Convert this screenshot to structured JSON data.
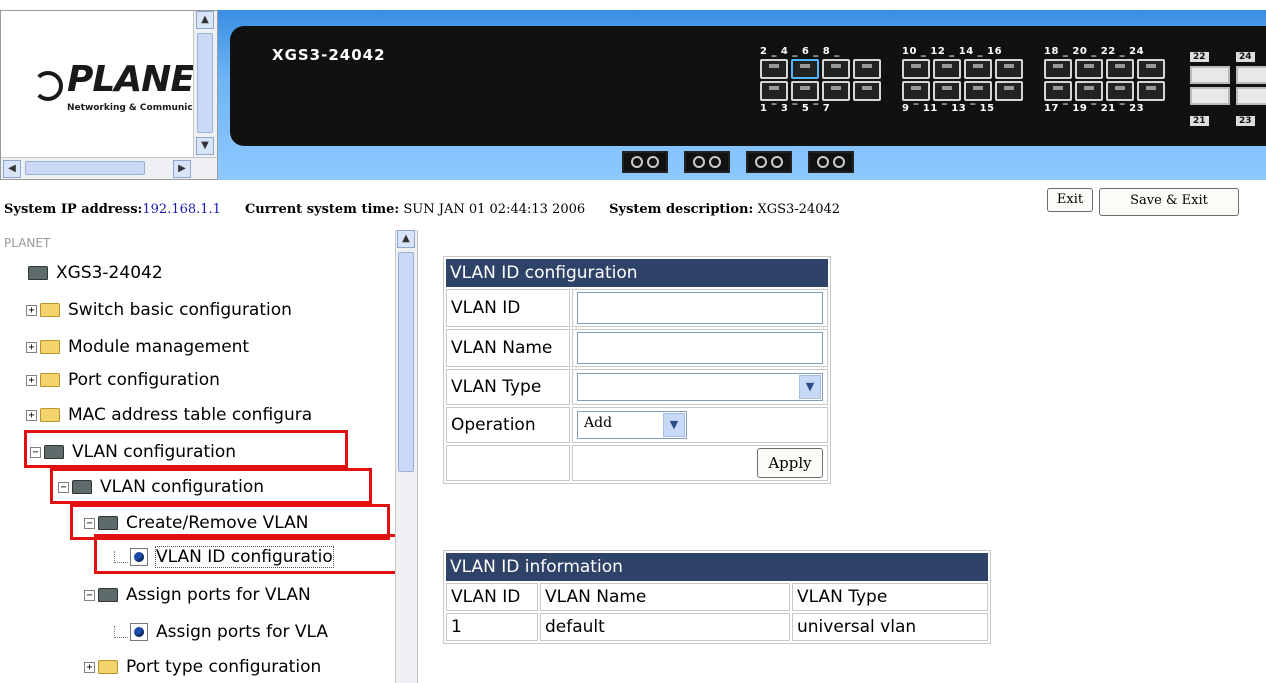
{
  "banner": {
    "logo_text": "PLANE",
    "logo_subtext": "Networking & Communic",
    "model": "XGS3-24042",
    "top_port_numbers": [
      "2 _ 4 _ 6 _ 8 _",
      "10 _ 12 _ 14 _ 16",
      "18 _ 20 _ 22 _ 24"
    ],
    "bottom_port_numbers": [
      "1 ‾ 3 ‾ 5 ‾ 7",
      "9 ‾ 11 ‾ 13 ‾ 15",
      "17 ‾ 19 ‾ 21 ‾ 23"
    ],
    "sfp_labels": [
      "22",
      "24",
      "21",
      "23"
    ]
  },
  "status": {
    "ip_label": "System IP address:",
    "ip_value": "192.168.1.1",
    "time_label": "Current system time:",
    "time_value": "SUN JAN 01 02:44:13 2006",
    "desc_label": "System description:",
    "desc_value": "XGS3-24042",
    "exit_label": "Exit",
    "save_exit_label": "Save & Exit"
  },
  "nav": {
    "brand": "PLANET",
    "root": "XGS3-24042",
    "items": [
      "Switch basic configuration",
      "Module management",
      "Port configuration",
      "MAC address table configura",
      "VLAN configuration",
      "VLAN configuration",
      "Create/Remove VLAN",
      "VLAN ID configuratio",
      "Assign ports for VLAN",
      "Assign ports for VLA",
      "Port type configuration"
    ]
  },
  "config": {
    "header": "VLAN ID configuration",
    "vlan_id_label": "VLAN ID",
    "vlan_id_value": "",
    "vlan_name_label": "VLAN Name",
    "vlan_name_value": "",
    "vlan_type_label": "VLAN Type",
    "vlan_type_value": "",
    "operation_label": "Operation",
    "operation_value": "Add",
    "apply_label": "Apply"
  },
  "info": {
    "header": "VLAN ID information",
    "columns": [
      "VLAN ID",
      "VLAN Name",
      "VLAN Type"
    ],
    "rows": [
      [
        "1",
        "default",
        "universal vlan"
      ]
    ]
  }
}
